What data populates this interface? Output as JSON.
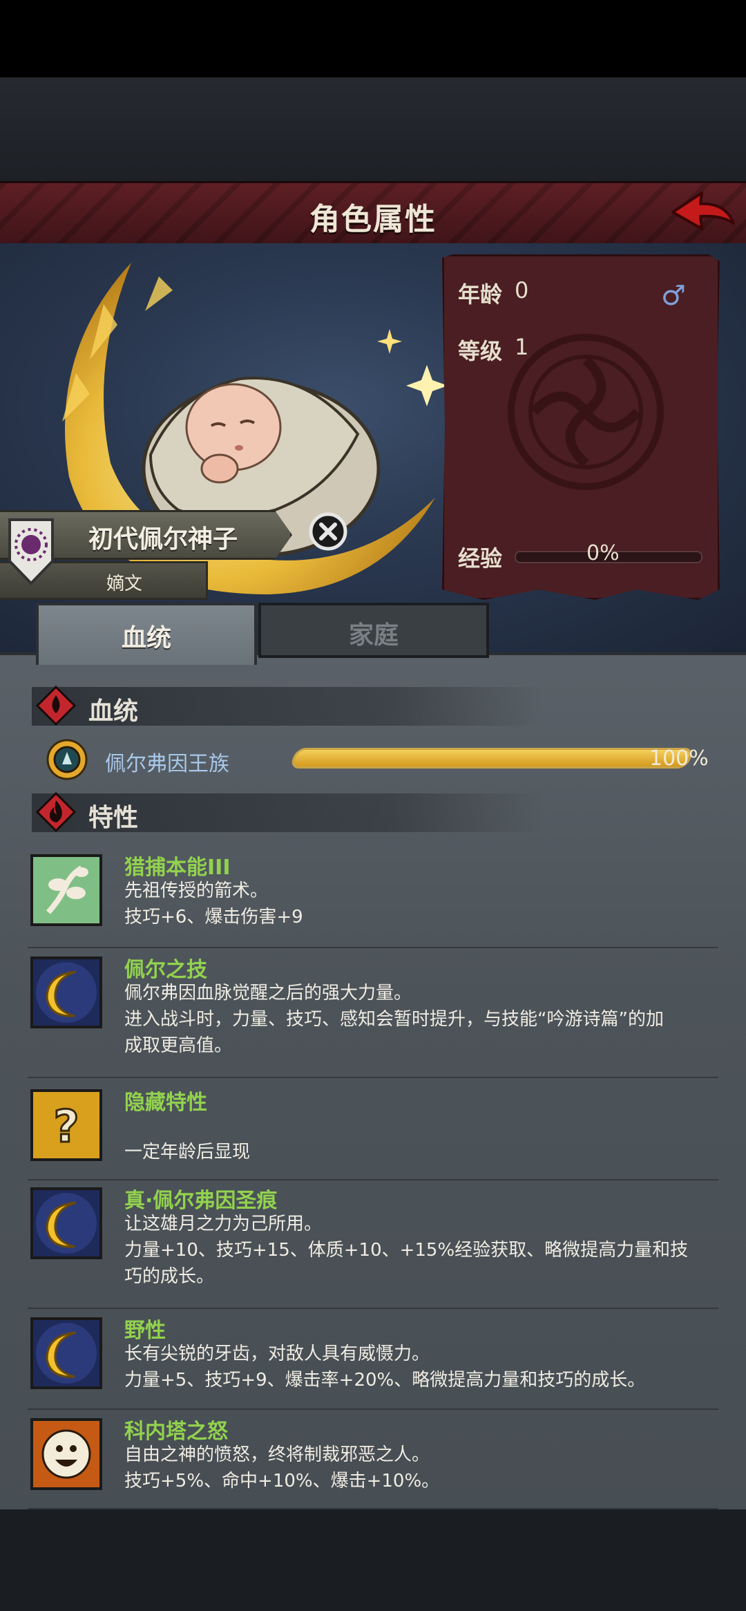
{
  "header": {
    "title": "角色属性"
  },
  "character": {
    "name": "初代佩尔神子",
    "subtitle": "嫡文",
    "age_label": "年龄",
    "age_value": "0",
    "gender_icon": "male-icon",
    "level_label": "等级",
    "level_value": "1",
    "exp_label": "经验",
    "exp_value": "0%",
    "exp_fraction": 0
  },
  "tabs": [
    {
      "label": "血统",
      "active": true
    },
    {
      "label": "家庭",
      "active": false
    }
  ],
  "bloodline_section": {
    "title": "血统",
    "lineage": {
      "name": "佩尔弗因王族",
      "percent_text": "100%",
      "fraction": 1.0
    }
  },
  "traits_section": {
    "title": "特性",
    "traits": [
      {
        "name": "猎捕本能III",
        "icon": "branch-icon",
        "lines": [
          "先祖传授的箭术。",
          "技巧+6、爆击伤害+9"
        ]
      },
      {
        "name": "佩尔之技",
        "icon": "crescent-icon",
        "lines": [
          "佩尔弗因血脉觉醒之后的强大力量。",
          "进入战斗时，力量、技巧、感知会暂时提升，与技能“吟游诗篇”的加",
          "成取更高值。"
        ]
      },
      {
        "name": "隐藏特性",
        "icon": "question-icon",
        "lines": [
          "",
          "一定年龄后显现"
        ]
      },
      {
        "name": "真·佩尔弗因圣痕",
        "icon": "crescent-icon",
        "lines": [
          "让这雄月之力为己所用。",
          "力量+10、技巧+15、体质+10、+15%经验获取、略微提高力量和技",
          "巧的成长。"
        ]
      },
      {
        "name": "野性",
        "icon": "crescent-icon",
        "lines": [
          "长有尖锐的牙齿，对敌人具有威慑力。",
          "力量+5、技巧+9、爆击率+20%、略微提高力量和技巧的成长。"
        ]
      },
      {
        "name": "科内塔之怒",
        "icon": "sun-face-icon",
        "lines": [
          "自由之神的愤怒，终将制裁邪恶之人。",
          "技巧+5%、命中+10%、爆击+10%。"
        ]
      }
    ]
  },
  "colors": {
    "trait_name": "#92d24e",
    "lineage_name": "#a8c8ea",
    "banner": "#5e1f24",
    "gold": "#e6b43a"
  }
}
